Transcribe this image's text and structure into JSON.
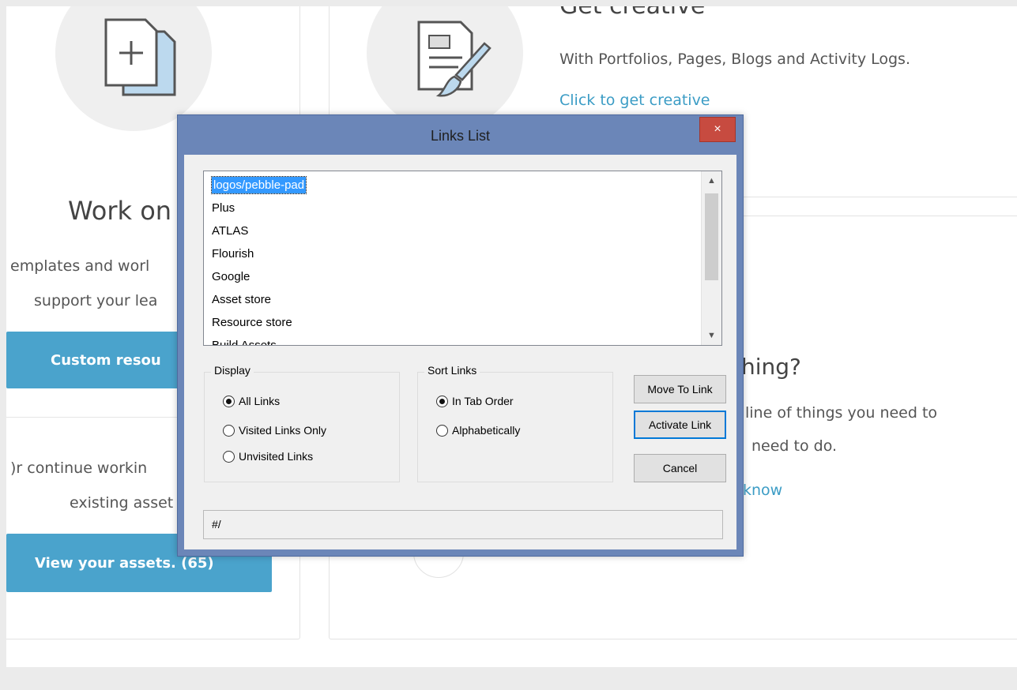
{
  "background_page": {
    "get_creative_title": "Get creative",
    "get_creative_desc": "With Portfolios, Pages, Blogs and Activity Logs.",
    "get_creative_link": "Click to get creative",
    "work_on_title": "Work on",
    "templates_text": "emplates and worl",
    "support_text": "support your lea",
    "custom_button": "Custom resou",
    "continue_text": ")r continue workin",
    "existing_text": "existing asset",
    "view_assets_button": "View your assets. (65)",
    "thing_title": "hing?",
    "outline_text": "line of things you need to",
    "need_to_do_text": "need to do.",
    "know_link": "know"
  },
  "dialog": {
    "title": "Links List",
    "close_label": "×",
    "links": [
      "logos/pebble-pad",
      "Plus",
      "ATLAS",
      "Flourish",
      "Google",
      "Asset store",
      "Resource store",
      "Build Assets"
    ],
    "display_group": {
      "label": "Display",
      "options": [
        "All Links",
        "Visited Links Only",
        "Unvisited Links"
      ]
    },
    "sort_group": {
      "label": "Sort Links",
      "options": [
        "In Tab Order",
        "Alphabetically"
      ]
    },
    "buttons": {
      "move_to_link": "Move To Link",
      "activate_link": "Activate Link",
      "cancel": "Cancel"
    },
    "url_value": "#/"
  },
  "colors": {
    "dialog_frame": "#6b86b8",
    "close_button": "#c74b40",
    "accent_blue": "#4aa3cc",
    "link_blue": "#3b9cc5",
    "selection": "#3399ff"
  }
}
